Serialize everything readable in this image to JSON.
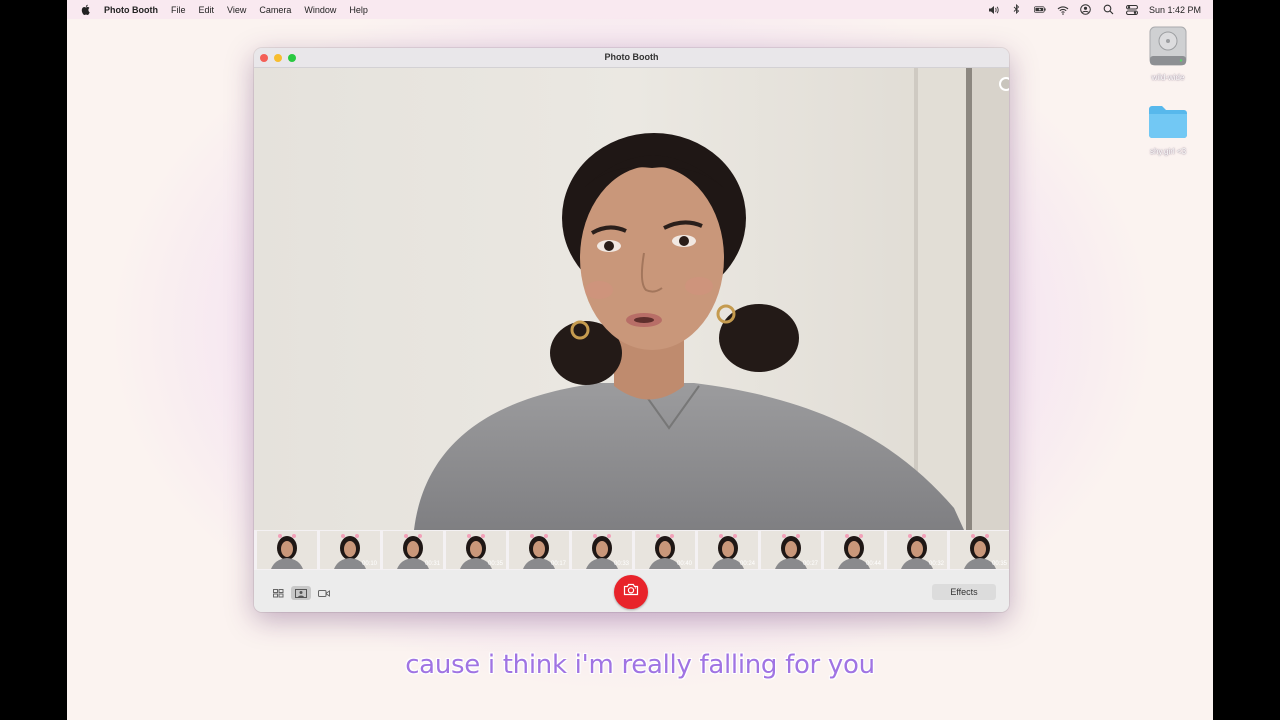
{
  "menubar": {
    "app_name": "Photo Booth",
    "items": [
      "File",
      "Edit",
      "View",
      "Camera",
      "Window",
      "Help"
    ],
    "clock": "Sun 1:42 PM",
    "status_icons": [
      "volume-icon",
      "bluetooth-icon",
      "battery-icon",
      "wifi-icon",
      "user-icon",
      "search-icon",
      "control-center-icon"
    ]
  },
  "desktop": {
    "icons": [
      {
        "label": "wild-wide",
        "icon": "drive-icon"
      },
      {
        "label": "shy.girl <3",
        "icon": "folder-icon"
      }
    ]
  },
  "window": {
    "title": "Photo Booth",
    "thumbnails": [
      "",
      "00:10",
      "00:31",
      "00:35",
      "00:17",
      "00:33",
      "00:40",
      "00:24",
      "00:27",
      "00:44",
      "00:32",
      "00:35"
    ],
    "effects_label": "Effects",
    "view_modes": [
      "grid-view-icon",
      "single-photo-icon",
      "video-icon"
    ]
  },
  "caption": "cause i think i'm really falling for you",
  "colors": {
    "shutter": "#e8232a",
    "caption": "#a074e3",
    "traffic_close": "#f45f57",
    "traffic_min": "#f7bd2f",
    "traffic_max": "#29c941"
  }
}
